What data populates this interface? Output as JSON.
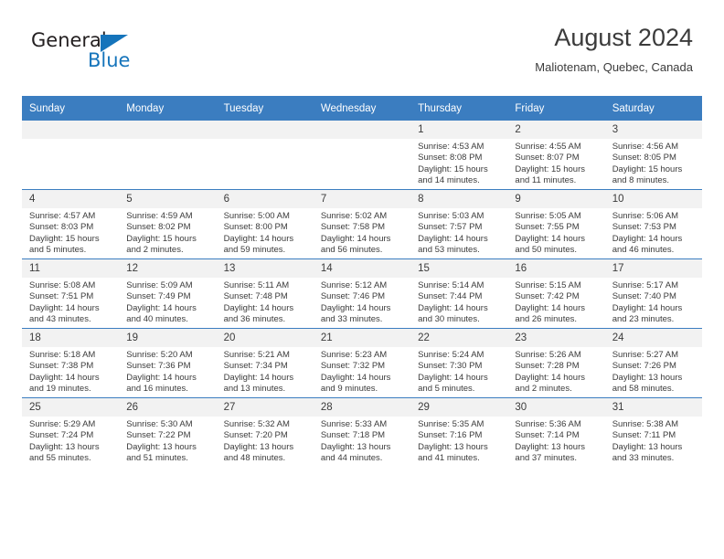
{
  "brand": {
    "name_dark": "General",
    "name_blue": "Blue",
    "color_blue": "#1574bb",
    "triangle_icon": "triangle-icon"
  },
  "header": {
    "title": "August 2024",
    "subtitle": "Maliotenam, Quebec, Canada",
    "header_bg": "#3b7dc0",
    "header_text_color": "#ffffff"
  },
  "calendar": {
    "weekday_headers": [
      "Sunday",
      "Monday",
      "Tuesday",
      "Wednesday",
      "Thursday",
      "Friday",
      "Saturday"
    ],
    "weeks": [
      [
        {
          "day": "",
          "lines": [
            "",
            "",
            "",
            ""
          ]
        },
        {
          "day": "",
          "lines": [
            "",
            "",
            "",
            ""
          ]
        },
        {
          "day": "",
          "lines": [
            "",
            "",
            "",
            ""
          ]
        },
        {
          "day": "",
          "lines": [
            "",
            "",
            "",
            ""
          ]
        },
        {
          "day": "1",
          "lines": [
            "Sunrise: 4:53 AM",
            "Sunset: 8:08 PM",
            "Daylight: 15 hours",
            "and 14 minutes."
          ]
        },
        {
          "day": "2",
          "lines": [
            "Sunrise: 4:55 AM",
            "Sunset: 8:07 PM",
            "Daylight: 15 hours",
            "and 11 minutes."
          ]
        },
        {
          "day": "3",
          "lines": [
            "Sunrise: 4:56 AM",
            "Sunset: 8:05 PM",
            "Daylight: 15 hours",
            "and 8 minutes."
          ]
        }
      ],
      [
        {
          "day": "4",
          "lines": [
            "Sunrise: 4:57 AM",
            "Sunset: 8:03 PM",
            "Daylight: 15 hours",
            "and 5 minutes."
          ]
        },
        {
          "day": "5",
          "lines": [
            "Sunrise: 4:59 AM",
            "Sunset: 8:02 PM",
            "Daylight: 15 hours",
            "and 2 minutes."
          ]
        },
        {
          "day": "6",
          "lines": [
            "Sunrise: 5:00 AM",
            "Sunset: 8:00 PM",
            "Daylight: 14 hours",
            "and 59 minutes."
          ]
        },
        {
          "day": "7",
          "lines": [
            "Sunrise: 5:02 AM",
            "Sunset: 7:58 PM",
            "Daylight: 14 hours",
            "and 56 minutes."
          ]
        },
        {
          "day": "8",
          "lines": [
            "Sunrise: 5:03 AM",
            "Sunset: 7:57 PM",
            "Daylight: 14 hours",
            "and 53 minutes."
          ]
        },
        {
          "day": "9",
          "lines": [
            "Sunrise: 5:05 AM",
            "Sunset: 7:55 PM",
            "Daylight: 14 hours",
            "and 50 minutes."
          ]
        },
        {
          "day": "10",
          "lines": [
            "Sunrise: 5:06 AM",
            "Sunset: 7:53 PM",
            "Daylight: 14 hours",
            "and 46 minutes."
          ]
        }
      ],
      [
        {
          "day": "11",
          "lines": [
            "Sunrise: 5:08 AM",
            "Sunset: 7:51 PM",
            "Daylight: 14 hours",
            "and 43 minutes."
          ]
        },
        {
          "day": "12",
          "lines": [
            "Sunrise: 5:09 AM",
            "Sunset: 7:49 PM",
            "Daylight: 14 hours",
            "and 40 minutes."
          ]
        },
        {
          "day": "13",
          "lines": [
            "Sunrise: 5:11 AM",
            "Sunset: 7:48 PM",
            "Daylight: 14 hours",
            "and 36 minutes."
          ]
        },
        {
          "day": "14",
          "lines": [
            "Sunrise: 5:12 AM",
            "Sunset: 7:46 PM",
            "Daylight: 14 hours",
            "and 33 minutes."
          ]
        },
        {
          "day": "15",
          "lines": [
            "Sunrise: 5:14 AM",
            "Sunset: 7:44 PM",
            "Daylight: 14 hours",
            "and 30 minutes."
          ]
        },
        {
          "day": "16",
          "lines": [
            "Sunrise: 5:15 AM",
            "Sunset: 7:42 PM",
            "Daylight: 14 hours",
            "and 26 minutes."
          ]
        },
        {
          "day": "17",
          "lines": [
            "Sunrise: 5:17 AM",
            "Sunset: 7:40 PM",
            "Daylight: 14 hours",
            "and 23 minutes."
          ]
        }
      ],
      [
        {
          "day": "18",
          "lines": [
            "Sunrise: 5:18 AM",
            "Sunset: 7:38 PM",
            "Daylight: 14 hours",
            "and 19 minutes."
          ]
        },
        {
          "day": "19",
          "lines": [
            "Sunrise: 5:20 AM",
            "Sunset: 7:36 PM",
            "Daylight: 14 hours",
            "and 16 minutes."
          ]
        },
        {
          "day": "20",
          "lines": [
            "Sunrise: 5:21 AM",
            "Sunset: 7:34 PM",
            "Daylight: 14 hours",
            "and 13 minutes."
          ]
        },
        {
          "day": "21",
          "lines": [
            "Sunrise: 5:23 AM",
            "Sunset: 7:32 PM",
            "Daylight: 14 hours",
            "and 9 minutes."
          ]
        },
        {
          "day": "22",
          "lines": [
            "Sunrise: 5:24 AM",
            "Sunset: 7:30 PM",
            "Daylight: 14 hours",
            "and 5 minutes."
          ]
        },
        {
          "day": "23",
          "lines": [
            "Sunrise: 5:26 AM",
            "Sunset: 7:28 PM",
            "Daylight: 14 hours",
            "and 2 minutes."
          ]
        },
        {
          "day": "24",
          "lines": [
            "Sunrise: 5:27 AM",
            "Sunset: 7:26 PM",
            "Daylight: 13 hours",
            "and 58 minutes."
          ]
        }
      ],
      [
        {
          "day": "25",
          "lines": [
            "Sunrise: 5:29 AM",
            "Sunset: 7:24 PM",
            "Daylight: 13 hours",
            "and 55 minutes."
          ]
        },
        {
          "day": "26",
          "lines": [
            "Sunrise: 5:30 AM",
            "Sunset: 7:22 PM",
            "Daylight: 13 hours",
            "and 51 minutes."
          ]
        },
        {
          "day": "27",
          "lines": [
            "Sunrise: 5:32 AM",
            "Sunset: 7:20 PM",
            "Daylight: 13 hours",
            "and 48 minutes."
          ]
        },
        {
          "day": "28",
          "lines": [
            "Sunrise: 5:33 AM",
            "Sunset: 7:18 PM",
            "Daylight: 13 hours",
            "and 44 minutes."
          ]
        },
        {
          "day": "29",
          "lines": [
            "Sunrise: 5:35 AM",
            "Sunset: 7:16 PM",
            "Daylight: 13 hours",
            "and 41 minutes."
          ]
        },
        {
          "day": "30",
          "lines": [
            "Sunrise: 5:36 AM",
            "Sunset: 7:14 PM",
            "Daylight: 13 hours",
            "and 37 minutes."
          ]
        },
        {
          "day": "31",
          "lines": [
            "Sunrise: 5:38 AM",
            "Sunset: 7:11 PM",
            "Daylight: 13 hours",
            "and 33 minutes."
          ]
        }
      ]
    ]
  }
}
